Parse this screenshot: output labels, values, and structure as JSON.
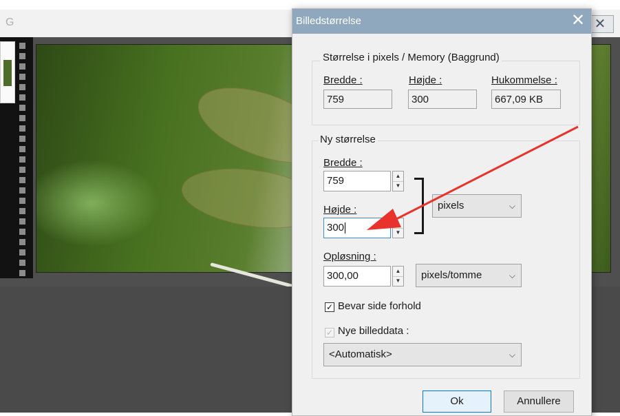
{
  "background_app": {
    "title_fragment": "G",
    "close_glyph": "✕"
  },
  "dialog": {
    "title": "Billedstørrelse",
    "close_glyph": "✕",
    "current_size": {
      "group_label": "Størrelse i pixels / Memory (Baggrund)",
      "width_label": "Bredde :",
      "width_value": "759",
      "height_label": "Højde :",
      "height_value": "300",
      "memory_label": "Hukommelse :",
      "memory_value": "667,09 KB"
    },
    "new_size": {
      "group_label": "Ny størrelse",
      "width_label": "Bredde :",
      "width_value": "759",
      "height_label": "Højde :",
      "height_value": "300",
      "unit_selected": "pixels",
      "resolution_label": "Opløsning :",
      "resolution_value": "300,00",
      "resolution_unit_selected": "pixels/tomme"
    },
    "keep_aspect_label": "Bevar side forhold",
    "keep_aspect_checked": true,
    "new_image_data_label": "Nye billeddata :",
    "new_image_data_checked": true,
    "new_image_data_enabled": false,
    "resample_selected": "<Automatisk>",
    "ok_label": "Ok",
    "cancel_label": "Annullere"
  },
  "annotation": {
    "arrow_color": "#e8332d"
  },
  "icons": {
    "spin_up": "▲",
    "spin_down": "▼",
    "dropdown": "⌵",
    "check": "✓"
  }
}
